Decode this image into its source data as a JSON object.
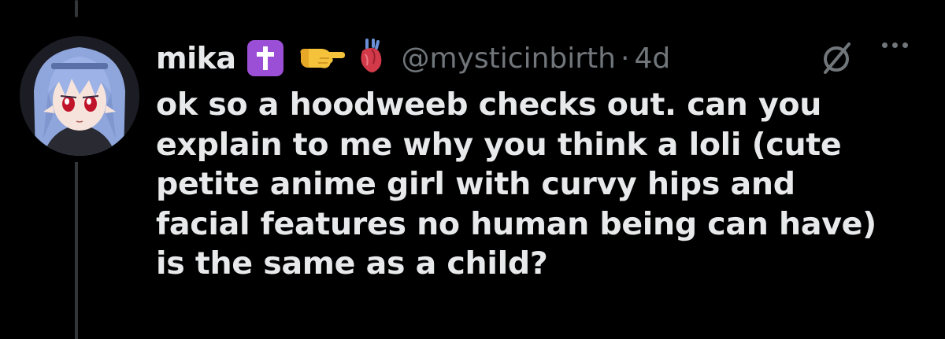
{
  "author": {
    "display_name": "mika",
    "emoji_icons": [
      "latin-cross-emoji",
      "pointing-hand-emoji",
      "anatomical-heart-emoji"
    ],
    "handle": "@mysticinbirth",
    "separator": "·",
    "timestamp": "4d",
    "avatar": "anime-girl-blue-hair-red-eyes"
  },
  "tweet": {
    "lines": [
      "ok so a hoodweeb checks out. can you",
      "explain to me why you think a loli (cute",
      "petite anime girl with curvy hips and",
      "facial features no human being can have)",
      "is the same as a child?"
    ]
  },
  "actions": {
    "grok_icon": "grok-icon",
    "more_icon": "more-icon"
  },
  "colors": {
    "background": "#000000",
    "text": "#e7e9ea",
    "muted": "#71767b",
    "badge": "#9b4fd6",
    "thread_line": "#333639"
  }
}
